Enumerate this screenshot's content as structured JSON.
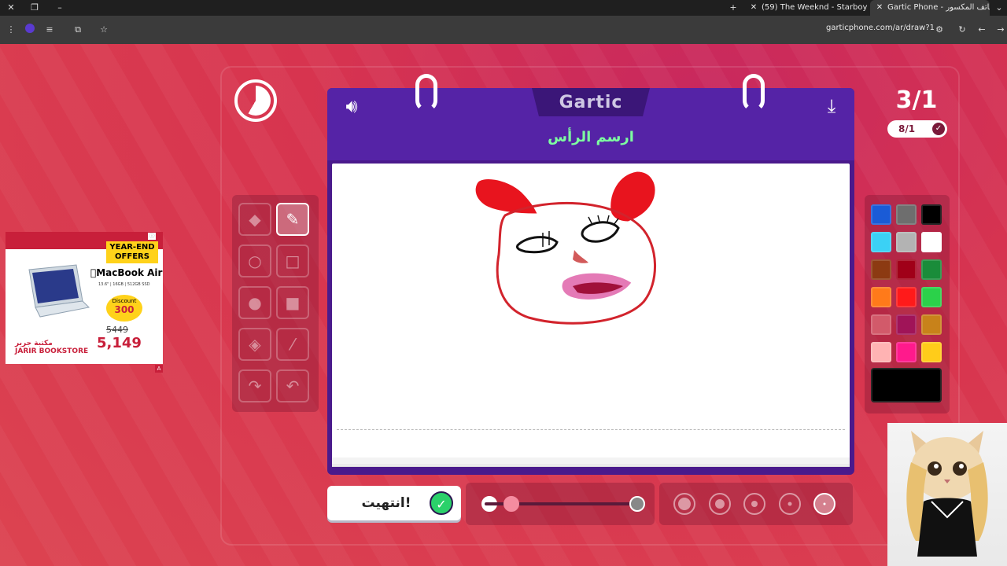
{
  "browser": {
    "tabs": [
      {
        "title": "(59) The Weeknd - Starboy"
      },
      {
        "title": "Gartic Phone - الهاتف المكسور"
      }
    ],
    "url": "garticphone.com/ar/draw?1"
  },
  "game": {
    "logo": "Gartic",
    "prompt": "ارسم الرأس",
    "round": "3/1",
    "players": "8/1",
    "done_label": "انتهيت!"
  },
  "ad": {
    "offer": "YEAR-END OFFERS",
    "brand": "MacBook Air",
    "spec": "13.6\" | 16GB | 512GB SSD",
    "discount_label": "Discount",
    "discount_value": "300",
    "old_price": "5449",
    "new_price": "5,149",
    "store": "JARIR BOOKSTORE",
    "store_ar": "مكتبة جرير"
  },
  "colors": {
    "palette": [
      "#1a5bd6",
      "#6e6e6e",
      "#000000",
      "#3bd1f5",
      "#b3b3b3",
      "#ffffff",
      "#8c3a12",
      "#a00018",
      "#1a8c3a",
      "#ff7a1a",
      "#ff1a1a",
      "#2bd14a",
      "#d25a6a",
      "#a01458",
      "#c8821a",
      "#ffb3b3",
      "#ff1a8c",
      "#ffcc1a"
    ],
    "selected": "#000000"
  },
  "tools": [
    "pen",
    "eraser",
    "rect",
    "ellipse",
    "rect-filled",
    "ellipse-filled",
    "line",
    "fill",
    "redo",
    "undo"
  ],
  "opacity": 1.0,
  "brush_size_selected": 5
}
